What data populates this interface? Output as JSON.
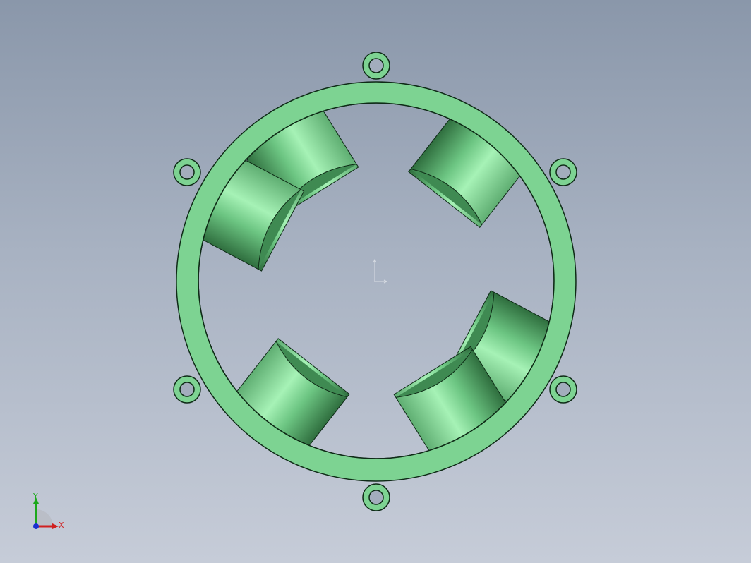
{
  "viewport": {
    "background_top": "#8a97aa",
    "background_bottom": "#c6ccd8"
  },
  "model": {
    "part_color": "#7dd392",
    "part_edge_color": "#0e2a16",
    "pipe_highlight": "#a6f2b6",
    "pipe_shadow": "#2f6e3e",
    "pipe_count": 6,
    "bolt_hole_count": 6
  },
  "triad": {
    "x_label": "X",
    "y_label": "Y",
    "x_color": "#d02020",
    "y_color": "#1ca81c",
    "z_color": "#1a2fd0"
  },
  "origin_icon": "origin-marker-icon"
}
